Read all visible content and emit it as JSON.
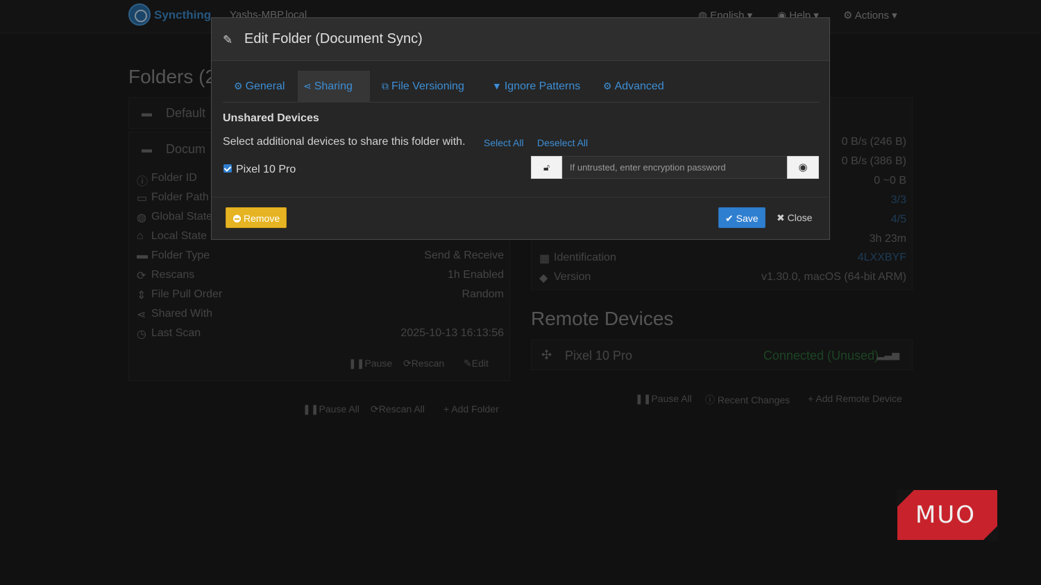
{
  "navbar": {
    "brand": "Syncthing",
    "hostname": "Yashs-MBP.local",
    "language": "English",
    "help": "Help",
    "actions": "Actions"
  },
  "folders": {
    "title": "Folders (2",
    "items": [
      "Default",
      "Docum"
    ],
    "details": [
      {
        "label": "Folder ID",
        "value": ""
      },
      {
        "label": "Folder Path",
        "value": ""
      },
      {
        "label": "Global State",
        "value": ""
      },
      {
        "label": "Local State",
        "value": ""
      },
      {
        "label": "Folder Type",
        "value": "Send & Receive"
      },
      {
        "label": "Rescans",
        "value": "1h   Enabled"
      },
      {
        "label": "File Pull Order",
        "value": "Random"
      },
      {
        "label": "Shared With",
        "value": ""
      },
      {
        "label": "Last Scan",
        "value": "2025-10-13 16:13:56"
      }
    ],
    "folder_buttons": {
      "pause": "Pause",
      "rescan": "Rescan",
      "edit": "Edit"
    },
    "all_buttons": {
      "pause_all": "Pause All",
      "rescan_all": "Rescan All",
      "add_folder": "Add Folder"
    }
  },
  "this_device": {
    "rows": [
      {
        "label": "",
        "value": "0 B/s (246 B)"
      },
      {
        "label": "",
        "value": "0 B/s (386 B)"
      },
      {
        "label": "",
        "value": "0    ~0 B"
      },
      {
        "label": "",
        "value": "3/3"
      },
      {
        "label": "",
        "value": "4/5"
      },
      {
        "label": "",
        "value": "3h 23m"
      },
      {
        "label": "Identification",
        "value": "4LXXBYF"
      },
      {
        "label": "Version",
        "value": "v1.30.0, macOS (64-bit ARM)"
      }
    ]
  },
  "remote_devices": {
    "title": "Remote Devices",
    "device_name": "Pixel 10 Pro",
    "device_status": "Connected (Unused)",
    "buttons": {
      "pause_all": "Pause All",
      "recent_changes": "Recent Changes",
      "add_remote": "Add Remote Device"
    }
  },
  "modal": {
    "title": "Edit Folder (Document Sync)",
    "tabs": [
      {
        "label": "General",
        "icon": "gear-icon"
      },
      {
        "label": "Sharing",
        "icon": "share-icon"
      },
      {
        "label": "File Versioning",
        "icon": "copy-icon"
      },
      {
        "label": "Ignore Patterns",
        "icon": "filter-icon"
      },
      {
        "label": "Advanced",
        "icon": "cogs-icon"
      }
    ],
    "active_tab": "Sharing",
    "section_heading": "Unshared Devices",
    "section_text": "Select additional devices to share this folder with.",
    "select_all": "Select All",
    "deselect_all": "Deselect All",
    "device_label": "Pixel 10 Pro",
    "device_checked": true,
    "password_placeholder": "If untrusted, enter encryption password",
    "remove_label": "Remove",
    "save_label": "Save",
    "close_label": "Close"
  },
  "watermark": "MUO",
  "colors": {
    "accent": "#2f7fd0",
    "warning": "#e6b422",
    "watermark": "#c8232c"
  }
}
